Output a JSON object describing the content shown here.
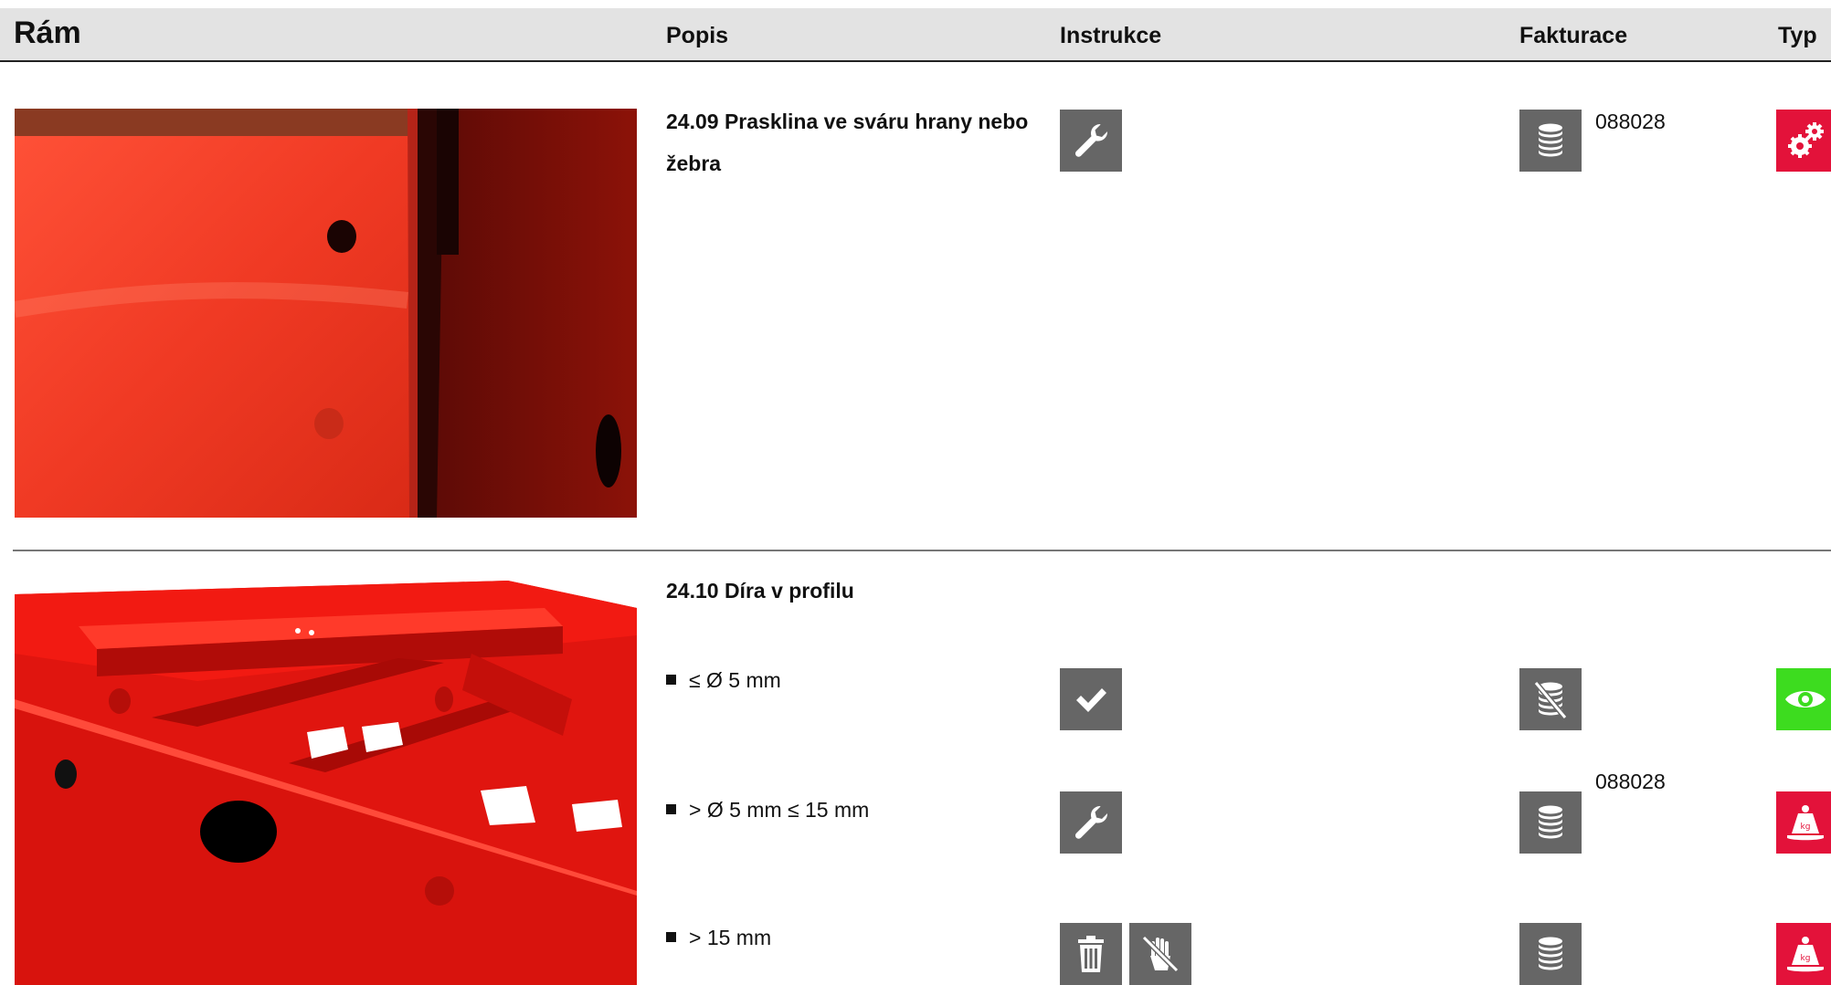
{
  "header": {
    "title": "Rám",
    "col_popis": "Popis",
    "col_instrukce": "Instrukce",
    "col_fakturace": "Fakturace",
    "col_typ": "Typ"
  },
  "entries": [
    {
      "title": "24.09 Prasklina ve sváru hrany nebo žebra",
      "instruction_icon": "wrench-icon",
      "billing_icon": "coins-icon",
      "code": "088028",
      "type_icon": "gears-icon",
      "type_color": "#e3123a"
    },
    {
      "title": "24.10 Díra v profilu",
      "options": [
        {
          "label": "≤ Ø 5 mm",
          "instruction_icons": [
            "checkmark-icon"
          ],
          "billing_icon": "coins-crossed-icon",
          "code": "",
          "type_icon": "eye-icon",
          "type_color": "#3ddc1f"
        },
        {
          "label": "> Ø 5 mm ≤ 15 mm",
          "instruction_icons": [
            "wrench-icon"
          ],
          "billing_icon": "coins-icon",
          "code": "088028",
          "type_icon": "weight-icon",
          "type_color": "#e3123a"
        },
        {
          "label": "> 15 mm",
          "instruction_icons": [
            "trash-icon",
            "no-touch-icon"
          ],
          "billing_icon": "coins-icon",
          "code": "",
          "type_icon": "weight-icon",
          "type_color": "#e3123a"
        }
      ]
    }
  ],
  "colors": {
    "header_bg": "#e3e3e3",
    "icon_bg": "#666666",
    "frame_red": "#e0150f"
  }
}
